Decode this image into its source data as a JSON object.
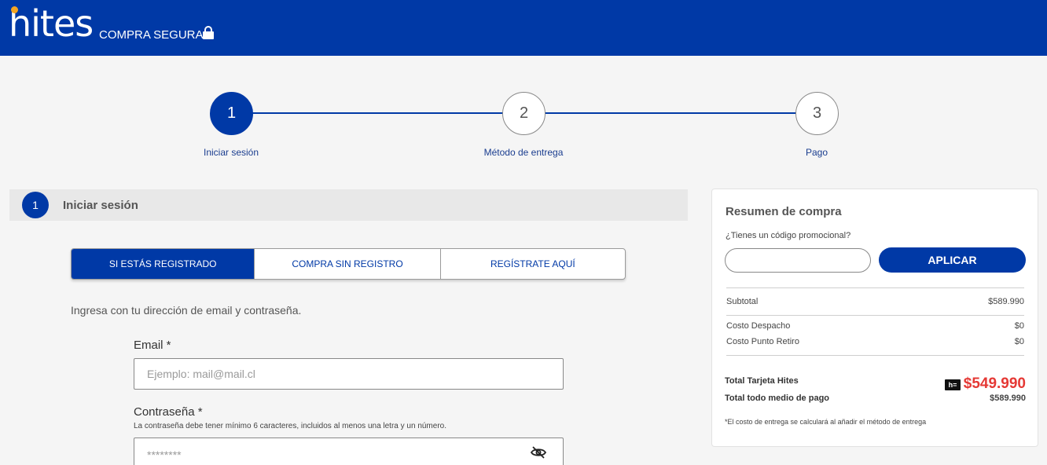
{
  "header": {
    "logo_text": "hites",
    "secure_label": "COMPRA SEGURA",
    "lock_icon": "lock-icon",
    "background_color": "#0039a6"
  },
  "steps": [
    {
      "number": "1",
      "label": "Iniciar sesión",
      "active": true
    },
    {
      "number": "2",
      "label": "Método de entrega",
      "active": false
    },
    {
      "number": "3",
      "label": "Pago",
      "active": false
    }
  ],
  "section": {
    "number": "1",
    "title": "Iniciar sesión"
  },
  "tabs": [
    {
      "label": "SI ESTÁS REGISTRADO",
      "active": true
    },
    {
      "label": "COMPRA SIN REGISTRO",
      "active": false
    },
    {
      "label": "REGÍSTRATE AQUÍ",
      "active": false
    }
  ],
  "login": {
    "intro": "Ingresa con tu dirección de email y contraseña.",
    "email_label": "Email *",
    "email_placeholder": "Ejemplo: mail@mail.cl",
    "password_label": "Contraseña *",
    "password_hint": "La contraseña debe tener mínimo 6 caracteres, incluidos al menos una letra y un número.",
    "password_placeholder": "********",
    "eye_icon": "eye-slash-icon"
  },
  "summary": {
    "title": "Resumen de compra",
    "promo_label": "¿Tienes un código promocional?",
    "promo_value": "",
    "apply_label": "APLICAR",
    "subtotal_label": "Subtotal",
    "subtotal_value": "$589.990",
    "despacho_label": "Costo Despacho",
    "despacho_value": "$0",
    "retiro_label": "Costo Punto Retiro",
    "retiro_value": "$0",
    "total_card_label": "Total Tarjeta Hites",
    "total_card_value": "$549.990",
    "card_badge": "h=",
    "total_all_label": "Total todo medio de pago",
    "total_all_value": "$589.990",
    "note": "*El costo de entrega se calculará al añadir el método de entrega",
    "price_color": "#e53935"
  }
}
